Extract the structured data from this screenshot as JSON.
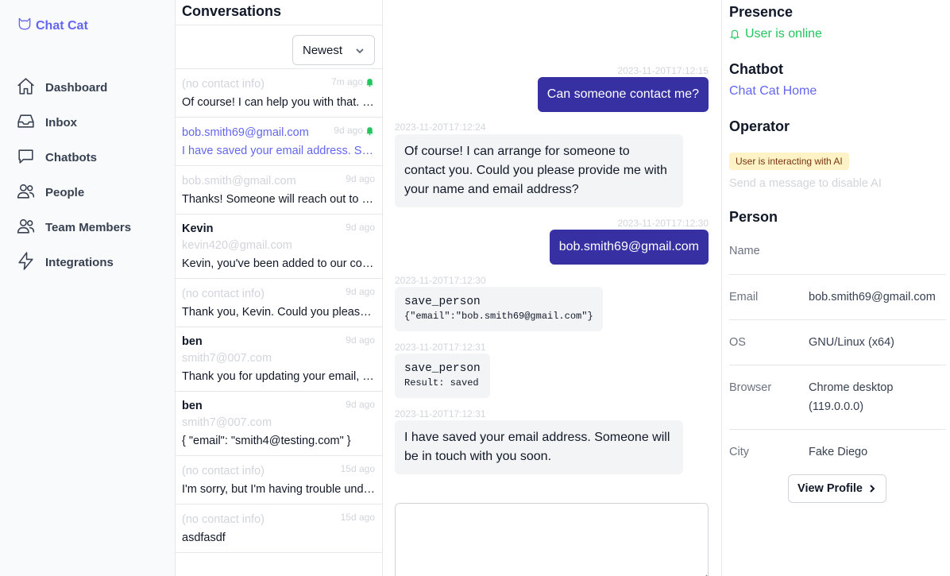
{
  "brand": {
    "name": "Chat Cat",
    "color": "#6366f1"
  },
  "nav": [
    {
      "label": "Dashboard",
      "icon": "home-icon"
    },
    {
      "label": "Inbox",
      "icon": "inbox-icon"
    },
    {
      "label": "Chatbots",
      "icon": "chat-bubble-icon"
    },
    {
      "label": "People",
      "icon": "users-icon"
    },
    {
      "label": "Team Members",
      "icon": "users-icon"
    },
    {
      "label": "Integrations",
      "icon": "bolt-icon"
    }
  ],
  "conversations": {
    "title": "Conversations",
    "sort": "Newest",
    "items": [
      {
        "name": "",
        "contact": "(no contact info)",
        "preview": "Of course! I can help you with that. Could you please provide me with your email address?",
        "time": "7m ago",
        "bell": true,
        "selected": false
      },
      {
        "name": "",
        "contact": "bob.smith69@gmail.com",
        "preview": "I have saved your email address. Someone will be in touch with you soon.",
        "time": "9d ago",
        "bell": true,
        "selected": true
      },
      {
        "name": "",
        "contact": "bob.smith@gmail.com",
        "preview": "Thanks! Someone will reach out to you soon.",
        "time": "9d ago",
        "bell": false,
        "selected": false
      },
      {
        "name": "Kevin",
        "contact": "kevin420@gmail.com",
        "preview": "Kevin, you've been added to our contact list.",
        "time": "9d ago",
        "bell": false,
        "selected": false
      },
      {
        "name": "",
        "contact": "(no contact info)",
        "preview": "Thank you, Kevin. Could you please provide your email address?",
        "time": "9d ago",
        "bell": false,
        "selected": false
      },
      {
        "name": "ben",
        "contact": "smith7@007.com",
        "preview": "Thank you for updating your email, Ben.",
        "time": "9d ago",
        "bell": false,
        "selected": false
      },
      {
        "name": "ben",
        "contact": "smith7@007.com",
        "preview": "{ \"email\": \"smith4@testing.com\" }",
        "time": "9d ago",
        "bell": false,
        "selected": false
      },
      {
        "name": "",
        "contact": "(no contact info)",
        "preview": "I'm sorry, but I'm having trouble understanding your request.",
        "time": "15d ago",
        "bell": false,
        "selected": false
      },
      {
        "name": "",
        "contact": "(no contact info)",
        "preview": "asdfasdf",
        "time": "15d ago",
        "bell": false,
        "selected": false
      }
    ]
  },
  "chat": {
    "messages": [
      {
        "ts": "2023-11-20T17:12:15",
        "text": "Can someone contact me?"
      },
      {
        "ts": "2023-11-20T17:12:24",
        "text": "Of course! I can arrange for someone to contact you. Could you please provide me with your name and email address?"
      },
      {
        "ts": "2023-11-20T17:12:30",
        "text": "bob.smith69@gmail.com"
      },
      {
        "ts": "2023-11-20T17:12:30",
        "tool": "save_person",
        "detail": "{\"email\":\"bob.smith69@gmail.com\"}"
      },
      {
        "ts": "2023-11-20T17:12:31",
        "tool": "save_person",
        "detail": "Result: saved"
      },
      {
        "ts": "2023-11-20T17:12:31",
        "text": "I have saved your email address. Someone will be in touch with you soon."
      }
    ],
    "composer_placeholder": ""
  },
  "panel": {
    "presence_title": "Presence",
    "presence_status": "User is online",
    "chatbot_title": "Chatbot",
    "chatbot_link": "Chat Cat Home",
    "operator_title": "Operator",
    "operator_badge": "User is interacting with AI",
    "operator_hint": "Send a message to disable AI",
    "person_title": "Person",
    "props": [
      {
        "label": "Name",
        "value": ""
      },
      {
        "label": "Email",
        "value": "bob.smith69@gmail.com"
      },
      {
        "label": "OS",
        "value": "GNU/Linux (x64)"
      },
      {
        "label": "Browser",
        "value": "Chrome desktop (119.0.0.0)"
      },
      {
        "label": "City",
        "value": "Fake Diego"
      }
    ],
    "view_profile": "View Profile"
  }
}
